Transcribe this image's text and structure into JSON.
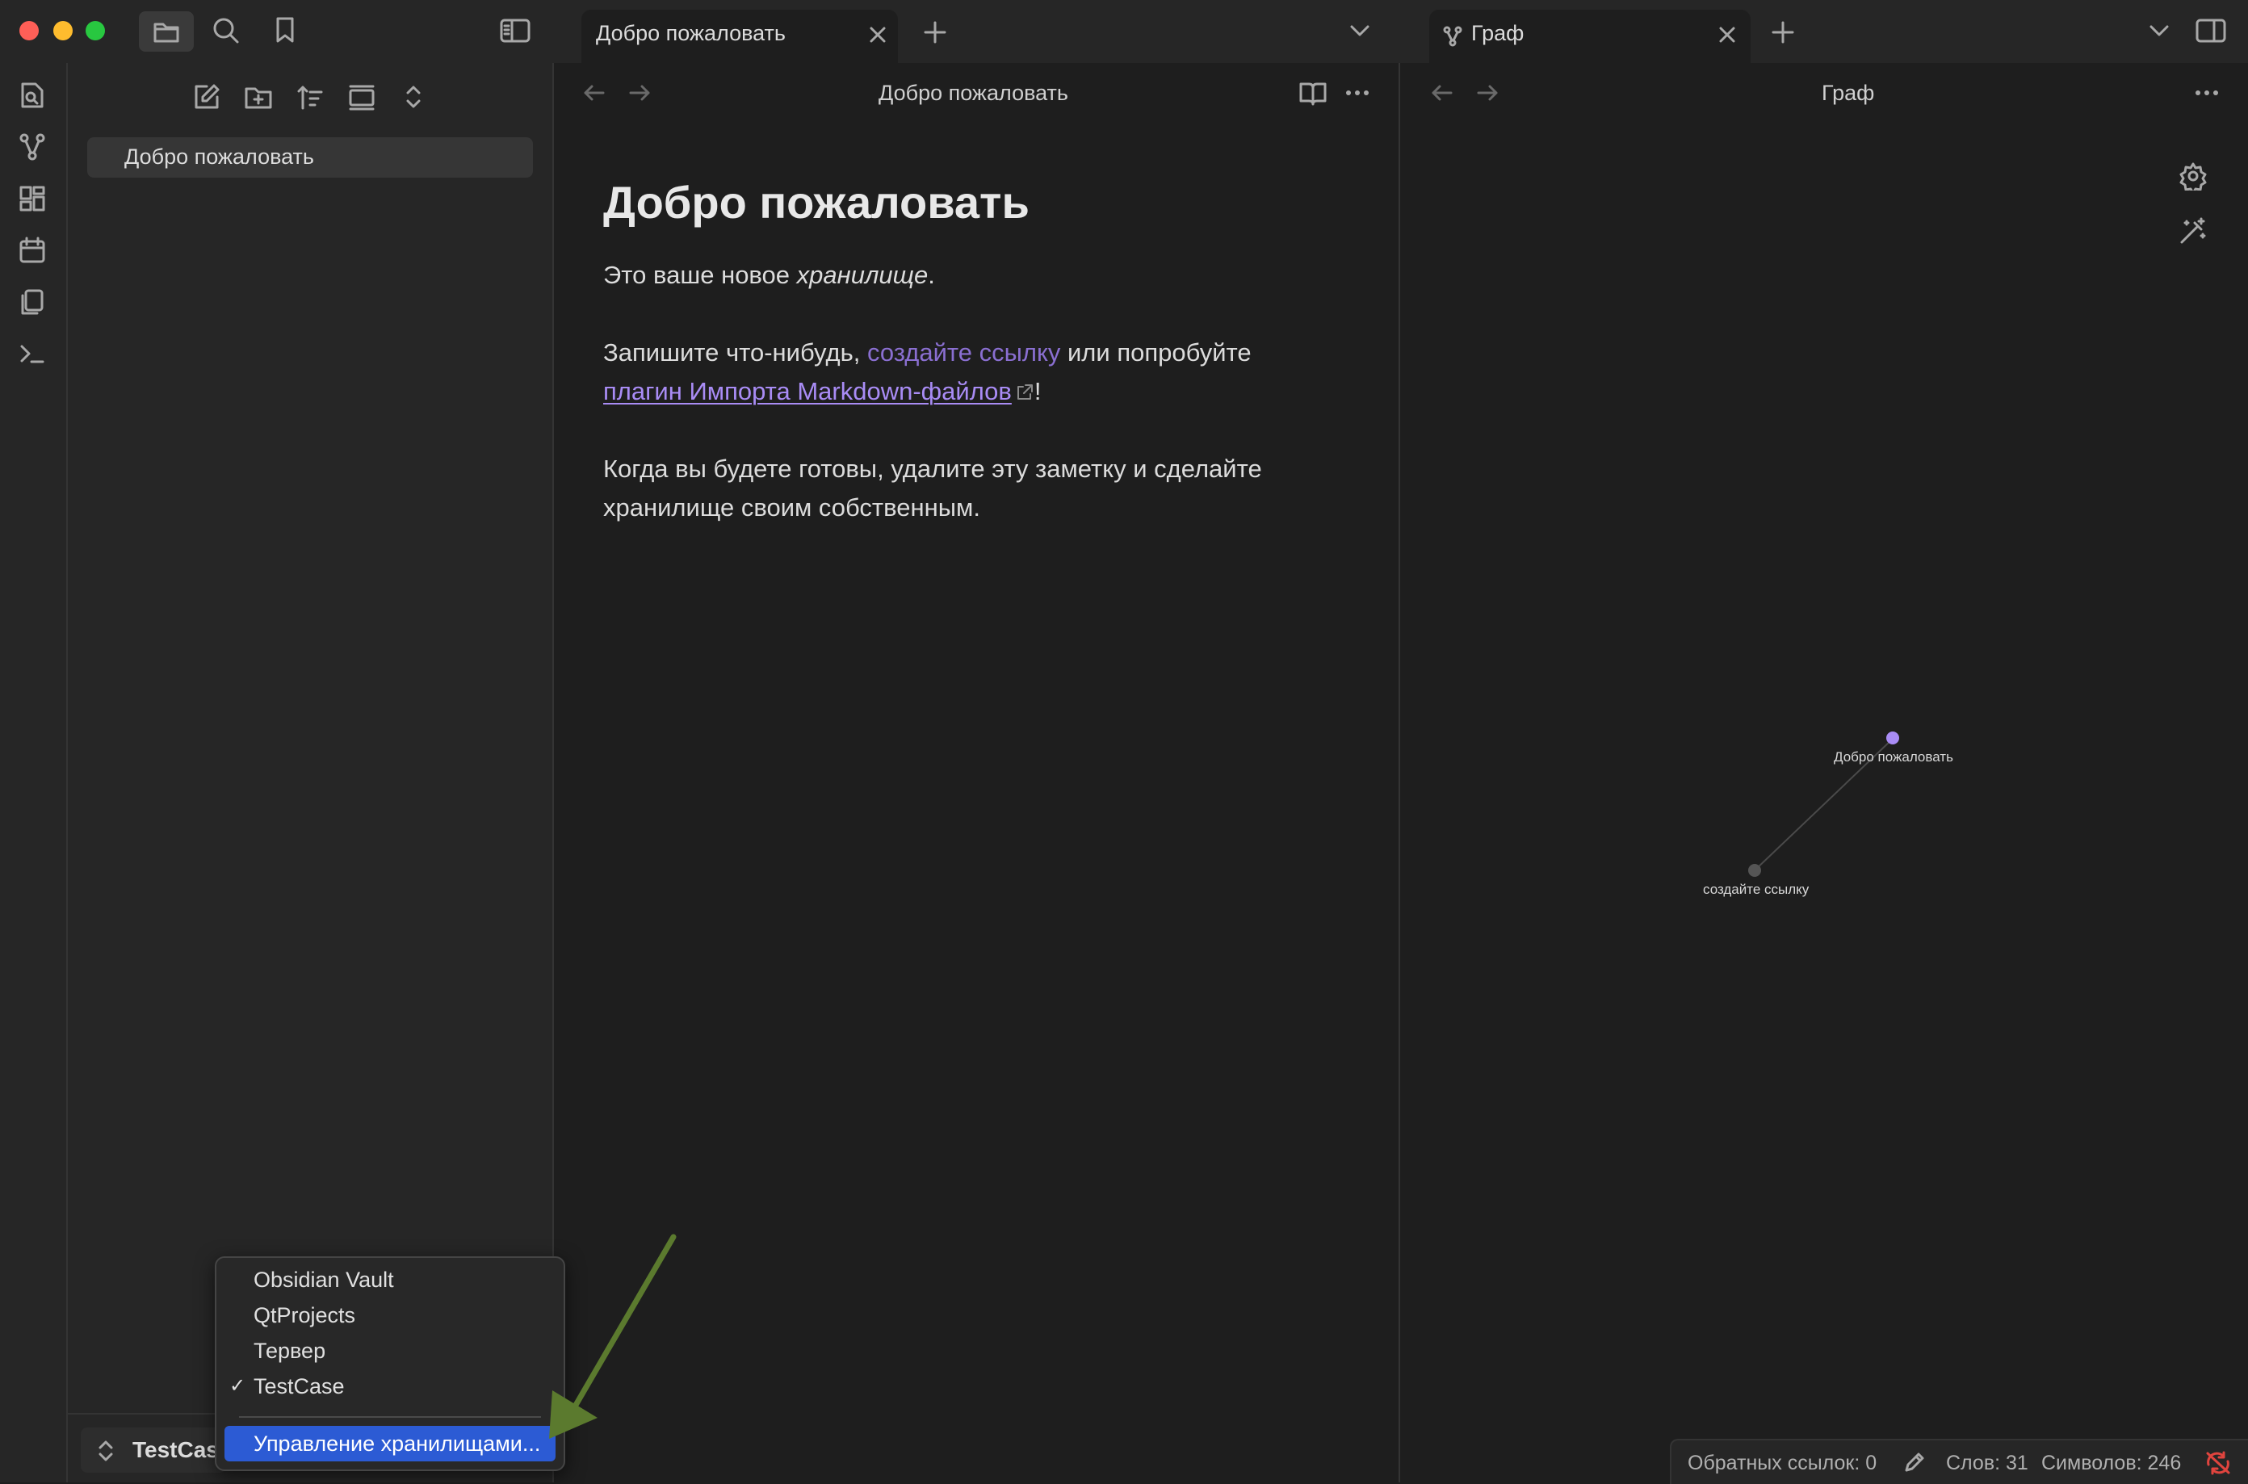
{
  "tabs": [
    {
      "label": "Добро пожаловать"
    },
    {
      "label": "Граф"
    }
  ],
  "sidebar": {
    "files": [
      {
        "label": "Добро пожаловать"
      }
    ],
    "vault_name": "TestCase"
  },
  "editor": {
    "view_title": "Добро пожаловать",
    "heading": "Добро пожаловать",
    "p1_before": "Это ваше новое ",
    "p1_italic": "хранилище",
    "p1_after": ".",
    "p2_before": "Запишите что-нибудь, ",
    "p2_link": "создайте ссылку",
    "p2_after": " или попробуйте",
    "p2_ext_link": "плагин Импорта Markdown-файлов",
    "p2_end": "!",
    "p3_line1": "Когда вы будете готовы, удалите эту заметку и сделайте",
    "p3_line2": "хранилище своим собственным."
  },
  "graph": {
    "view_title": "Граф",
    "nodes": [
      {
        "label": "Добро пожаловать",
        "color": "#a98cf5"
      },
      {
        "label": "создайте ссылку",
        "color": "#555555"
      }
    ]
  },
  "vault_menu": {
    "items": [
      "Obsidian Vault",
      "QtProjects",
      "Тервер",
      "TestCase"
    ],
    "checked": "TestCase",
    "check_mark": "✓",
    "manage": "Управление хранилищами..."
  },
  "status_bar": {
    "backlinks": "Обратных ссылок: 0",
    "words": "Слов: 31",
    "chars": "Символов: 246"
  },
  "colors": {
    "accent": "#a98cf5",
    "menu_highlight": "#2c5bd4",
    "annotation_arrow": "#5b7a2e",
    "sync_error": "#e0443e"
  }
}
